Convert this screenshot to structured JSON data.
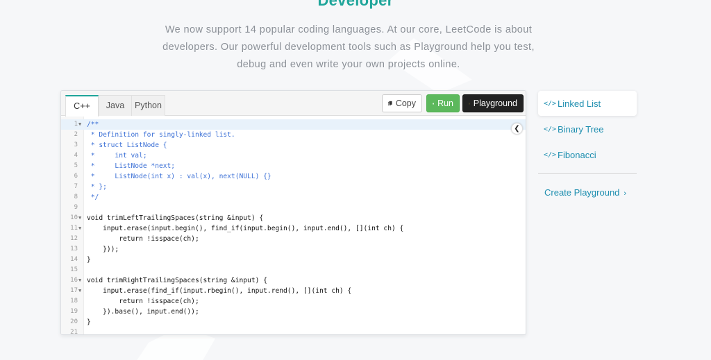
{
  "heading": "Developer",
  "intro": [
    "We now support 14 popular coding languages. At our core, LeetCode is about",
    "developers. Our powerful development tools such as Playground help you test,",
    "debug and even write your own projects online."
  ],
  "editor": {
    "tabs": [
      "C++",
      "Java",
      "Python"
    ],
    "active_tab": "C++",
    "buttons": {
      "copy": "Copy",
      "run": "Run",
      "playground": "Playground"
    },
    "lines": [
      {
        "n": "1",
        "fold": true,
        "comment": true,
        "text": "/**"
      },
      {
        "n": "2",
        "comment": true,
        "text": " * Definition for singly-linked list."
      },
      {
        "n": "3",
        "comment": true,
        "text": " * struct ListNode {"
      },
      {
        "n": "4",
        "comment": true,
        "text": " *     int val;"
      },
      {
        "n": "5",
        "comment": true,
        "text": " *     ListNode *next;"
      },
      {
        "n": "6",
        "comment": true,
        "text": " *     ListNode(int x) : val(x), next(NULL) {}"
      },
      {
        "n": "7",
        "comment": true,
        "text": " * };"
      },
      {
        "n": "8",
        "comment": true,
        "text": " */"
      },
      {
        "n": "9",
        "text": ""
      },
      {
        "n": "10",
        "fold": true,
        "text": "void trimLeftTrailingSpaces(string &input) {"
      },
      {
        "n": "11",
        "fold": true,
        "text": "    input.erase(input.begin(), find_if(input.begin(), input.end(), [](int ch) {"
      },
      {
        "n": "12",
        "text": "        return !isspace(ch);"
      },
      {
        "n": "13",
        "text": "    }));"
      },
      {
        "n": "14",
        "text": "}"
      },
      {
        "n": "15",
        "text": ""
      },
      {
        "n": "16",
        "fold": true,
        "text": "void trimRightTrailingSpaces(string &input) {"
      },
      {
        "n": "17",
        "fold": true,
        "text": "    input.erase(find_if(input.rbegin(), input.rend(), [](int ch) {"
      },
      {
        "n": "18",
        "text": "        return !isspace(ch);"
      },
      {
        "n": "19",
        "text": "    }).base(), input.end());"
      },
      {
        "n": "20",
        "text": "}"
      },
      {
        "n": "21",
        "text": ""
      }
    ]
  },
  "side_menu": {
    "items": [
      "Linked List",
      "Binary Tree",
      "Fibonacci"
    ],
    "active": "Linked List",
    "icon": "</>",
    "create_label": "Create Playground"
  },
  "colors": {
    "accent": "#1fa59a",
    "link": "#1f8fb0",
    "run": "#5cb85c",
    "comment": "#3a6fd6"
  }
}
